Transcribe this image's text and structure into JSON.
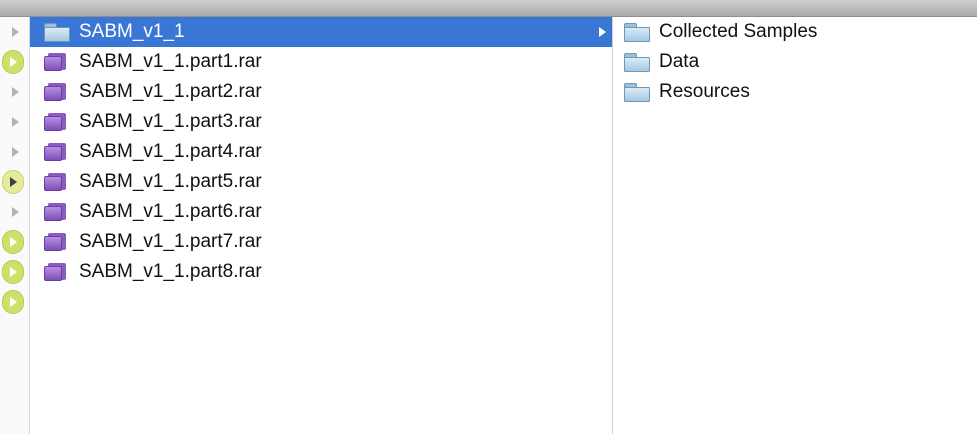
{
  "column1": {
    "items": [
      {
        "label": "SABM_v1_1",
        "icon": "folder-icon",
        "selected": true
      },
      {
        "label": "SABM_v1_1.part1.rar",
        "icon": "rar-archive-icon"
      },
      {
        "label": "SABM_v1_1.part2.rar",
        "icon": "rar-archive-icon"
      },
      {
        "label": "SABM_v1_1.part3.rar",
        "icon": "rar-archive-icon"
      },
      {
        "label": "SABM_v1_1.part4.rar",
        "icon": "rar-archive-icon"
      },
      {
        "label": "SABM_v1_1.part5.rar",
        "icon": "rar-archive-icon"
      },
      {
        "label": "SABM_v1_1.part6.rar",
        "icon": "rar-archive-icon"
      },
      {
        "label": "SABM_v1_1.part7.rar",
        "icon": "rar-archive-icon"
      },
      {
        "label": "SABM_v1_1.part8.rar",
        "icon": "rar-archive-icon"
      }
    ]
  },
  "column2": {
    "items": [
      {
        "label": "Collected Samples",
        "icon": "folder-icon"
      },
      {
        "label": "Data",
        "icon": "folder-icon"
      },
      {
        "label": "Resources",
        "icon": "folder-icon"
      }
    ]
  },
  "gutter": {
    "markers": [
      "grey-triangle",
      "play-badge",
      "grey-triangle",
      "grey-triangle",
      "grey-triangle",
      "dark-triangle",
      "grey-triangle",
      "play-badge",
      "play-badge",
      "play-badge"
    ]
  },
  "colors": {
    "selection": "#3a76d6",
    "play_badge": "#cfe06a",
    "rar_icon": "#8a5bc0",
    "folder_icon": "#a6c8e2"
  }
}
